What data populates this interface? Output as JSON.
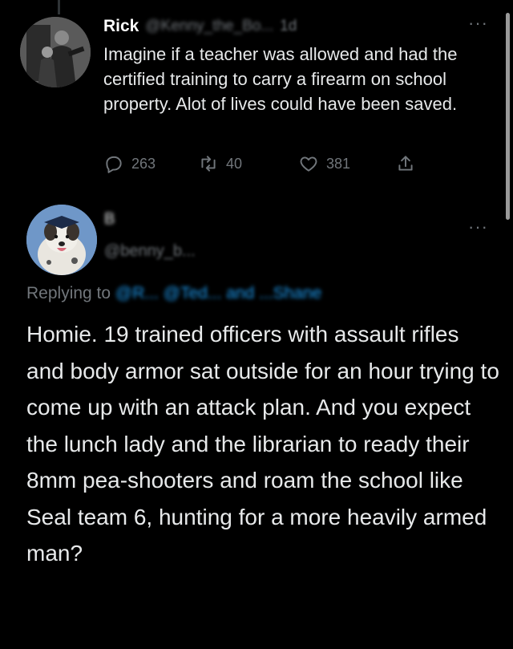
{
  "parent_tweet": {
    "display_name": "Rick",
    "handle": "@Kenny_the_Bo...",
    "timestamp": "1d",
    "text": "Imagine if a teacher was allowed and had the certified training to carry a firearm on school property. Alot of lives could have been saved.",
    "actions": {
      "reply_count": "263",
      "retweet_count": "40",
      "like_count": "381"
    }
  },
  "reply_tweet": {
    "display_name": "B",
    "handle": "@benny_b...",
    "replying_prefix": "Replying to",
    "replying_mentions": "@R... @Ted... and ...Shane",
    "text": "Homie. 19 trained officers with assault rifles and body armor sat outside for an hour trying to come up with an attack plan. And you expect the lunch lady and the librarian to ready their 8mm pea-shooters and roam the school like Seal team 6, hunting for a more heavily armed man?"
  },
  "icons": {
    "reply": "speech-bubble-icon",
    "retweet": "retweet-icon",
    "like": "heart-icon",
    "share": "share-icon",
    "more": "more-options-icon"
  },
  "colors": {
    "background": "#000000",
    "text": "#e7e9ea",
    "secondary": "#71767b",
    "link": "#1d9bf0"
  }
}
